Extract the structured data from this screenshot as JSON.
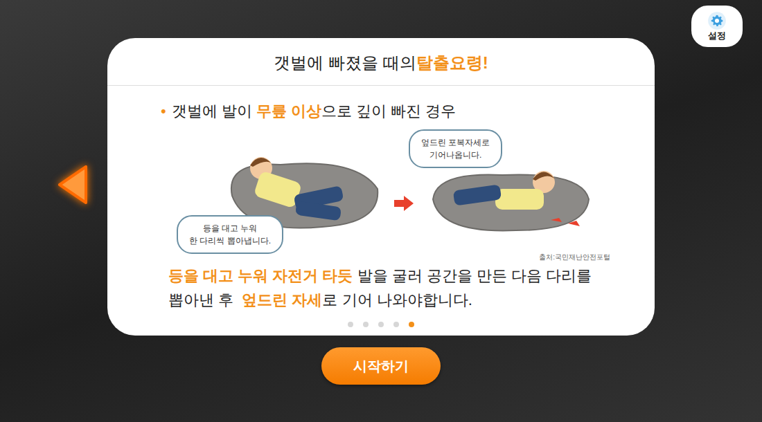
{
  "settings_button": {
    "label": "설정"
  },
  "card": {
    "title": [
      {
        "text": "갯벌에 빠졌을 때의 ",
        "highlight": false
      },
      {
        "text": "탈출요령!",
        "highlight": true
      }
    ],
    "bullet": {
      "marker": "•",
      "segments": [
        {
          "text": "갯벌에 발이 ",
          "highlight": false
        },
        {
          "text": "무릎 이상",
          "highlight": true
        },
        {
          "text": "으로 깊이 빠진 경우",
          "highlight": false
        }
      ]
    },
    "illustration": {
      "steps": [
        {
          "bubble": [
            "등을 대고 누워",
            "한 다리씩 뽑아냅니다."
          ]
        },
        {
          "bubble": [
            "엎드린 포복자세로",
            "기어나옵니다."
          ]
        }
      ],
      "source": "출처:국민재난안전포털"
    },
    "body_lines": [
      [
        {
          "text": "등을 대고 누워 자전거 타듯",
          "highlight": true
        },
        {
          "text": " 발을 굴러 공간을 만든 다음 다리를",
          "highlight": false
        }
      ],
      [
        {
          "text": "뽑아낸 후  ",
          "highlight": false
        },
        {
          "text": "엎드린 자세",
          "highlight": true
        },
        {
          "text": "로 기어 나와야합니다.",
          "highlight": false
        }
      ]
    ],
    "pagination": [
      {
        "selected": false
      },
      {
        "selected": false
      },
      {
        "selected": false
      },
      {
        "selected": false
      },
      {
        "selected": true
      }
    ]
  },
  "start_button": {
    "label": "시작하기"
  }
}
